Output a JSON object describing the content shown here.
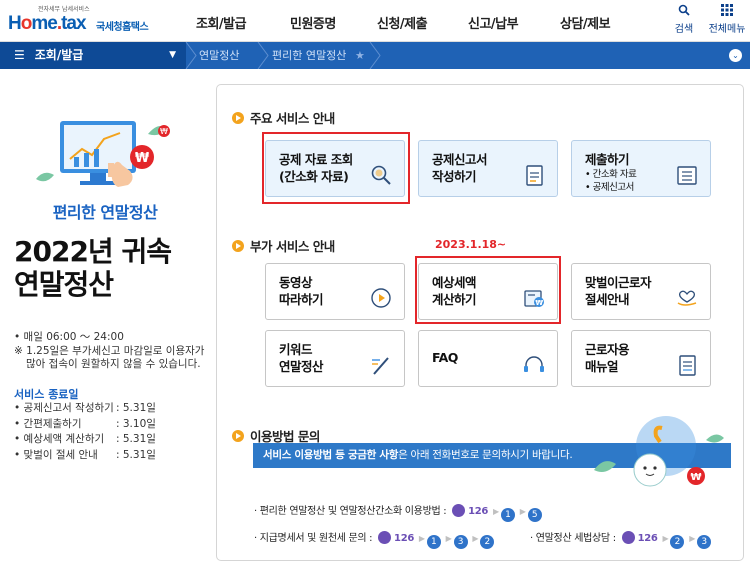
{
  "header": {
    "logo_small": "전자세무 납세서비스",
    "logo_text": "Hometax",
    "logo_korean": "국세청홈택스",
    "menu": [
      "조회/발급",
      "민원증명",
      "신청/제출",
      "신고/납부",
      "상담/제보"
    ],
    "search_label": "검색",
    "all_menu_label": "전체메뉴"
  },
  "navbar": {
    "menu_label": "조회/발급",
    "breadcrumb": [
      "연말정산",
      "편리한 연말정산"
    ]
  },
  "left": {
    "title": "편리한 연말정산",
    "big_title_line1": "2022년 귀속",
    "big_title_line2": "연말정산",
    "hours": "• 매일 06:00 ～ 24:00",
    "note": "※ 1.25일은 부가세신고 마감일로 이용자가 많아 접속이 원할하지 않을 수 있습니다.",
    "end_title": "서비스 종료일",
    "end_items": [
      {
        "name": "• 공제신고서 작성하기",
        "date": ": 5.31일"
      },
      {
        "name": "• 간편제출하기",
        "date": ": 3.10일"
      },
      {
        "name": "• 예상세액 계산하기",
        "date": ": 5.31일"
      },
      {
        "name": "• 맞벌이 절세 안내",
        "date": ": 5.31일"
      }
    ]
  },
  "main": {
    "section1": "주요 서비스 안내",
    "section2": "부가 서비스 안내",
    "section3": "이용방법 문의",
    "date_note": "2023.1.18~",
    "cards_main": [
      {
        "line1": "공제 자료 조회",
        "line2": "(간소화 자료)"
      },
      {
        "line1": "공제신고서",
        "line2": "작성하기"
      },
      {
        "line1": "제출하기",
        "sub1": "• 간소화 자료",
        "sub2": "• 공제신고서"
      }
    ],
    "cards_extra": [
      {
        "line1": "동영상",
        "line2": "따라하기"
      },
      {
        "line1": "예상세액",
        "line2": "계산하기"
      },
      {
        "line1": "맞벌이근로자",
        "line2": "절세안내"
      },
      {
        "line1": "키워드",
        "line2": "연말정산"
      },
      {
        "line1": "FAQ",
        "line2": ""
      },
      {
        "line1": "근로자용",
        "line2": "매뉴얼"
      }
    ],
    "banner_bold": "서비스 이용방법 등 궁금한 사항",
    "banner_rest": "은 아래 전화번호로 문의하시기 바랍니다.",
    "line1_label": "· 편리한 연말정산 및 연말정산간소화 이용방법 :",
    "line2_label": "· 지급명세서 및 원천세 문의 :",
    "line3_label": "· 연말정산 세법상담 :",
    "phone_number": "126",
    "line1_steps": [
      "1",
      "5"
    ],
    "line2_steps": [
      "1",
      "3",
      "2"
    ],
    "line3_steps": [
      "2",
      "3"
    ]
  },
  "colors": {
    "brand": "#1f62b5",
    "accent": "#f3a31d",
    "highlight": "#e3262a",
    "phone": "#6b4fb5"
  }
}
